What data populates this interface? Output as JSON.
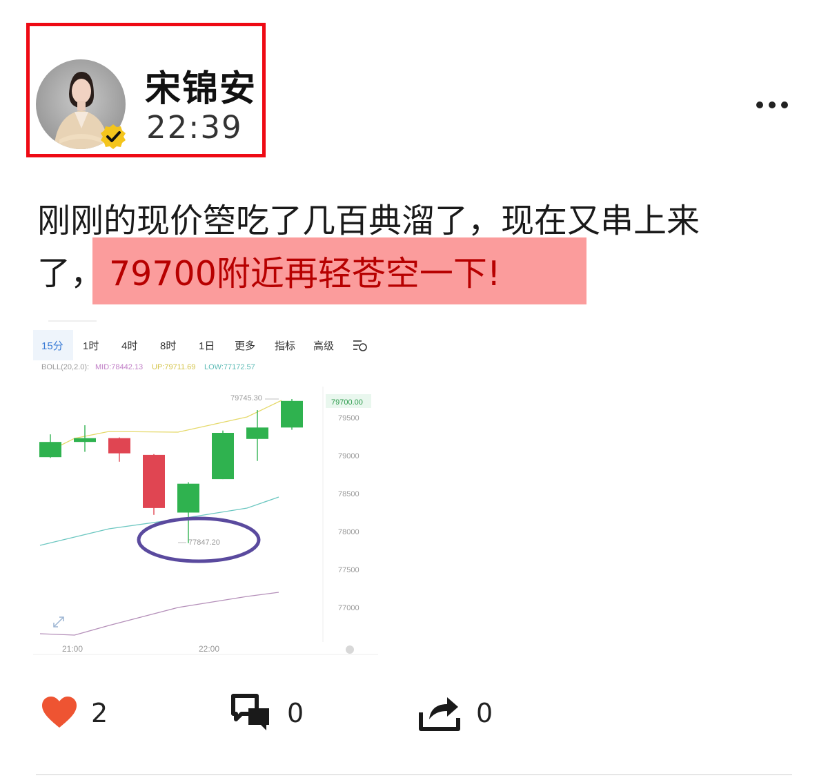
{
  "author": {
    "name": "宋锦安",
    "time": "22:39"
  },
  "post": {
    "text_line1": "刚刚的现价箜吃了几百典溜了，现在又串上来",
    "text_line2_prefix": "了，",
    "highlight": "79700附近再轻苍空一下!"
  },
  "chart_screenshot": {
    "tabs": [
      "15分",
      "1时",
      "4时",
      "8时",
      "1日",
      "更多",
      "指标",
      "高级"
    ],
    "active_tab": "15分",
    "boll_label": "BOLL(20,2.0):",
    "boll_mid": "MID:78442.13",
    "boll_up": "UP:79711.69",
    "boll_low": "LOW:77172.57",
    "high_label": "79745.30",
    "low_label": "77847.20",
    "current_price": "79700.00",
    "y_ticks": [
      "79500",
      "79000",
      "78500",
      "78000",
      "77500",
      "77000"
    ],
    "x_ticks": [
      "21:00",
      "22:00"
    ],
    "colors": {
      "up": "#2fb24f",
      "down": "#e04552",
      "up_band": "#e5d96a",
      "low_band": "#6cc7c1",
      "circle": "#5a4a9e"
    },
    "candles": [
      {
        "open": 78980,
        "close": 79180,
        "high": 79280,
        "low": 78970
      },
      {
        "open": 79180,
        "close": 79230,
        "high": 79400,
        "low": 79050
      },
      {
        "open": 79230,
        "close": 79030,
        "high": 79240,
        "low": 78920
      },
      {
        "open": 79010,
        "close": 78310,
        "high": 79020,
        "low": 78220
      },
      {
        "open": 78250,
        "close": 78630,
        "high": 78650,
        "low": 77847.2
      },
      {
        "open": 78690,
        "close": 79300,
        "high": 79330,
        "low": 78690
      },
      {
        "open": 79220,
        "close": 79370,
        "high": 79600,
        "low": 78930
      },
      {
        "open": 79370,
        "close": 79720,
        "high": 79745.3,
        "low": 79340
      }
    ]
  },
  "stats": {
    "likes": "2",
    "comments": "0",
    "shares": "0"
  }
}
